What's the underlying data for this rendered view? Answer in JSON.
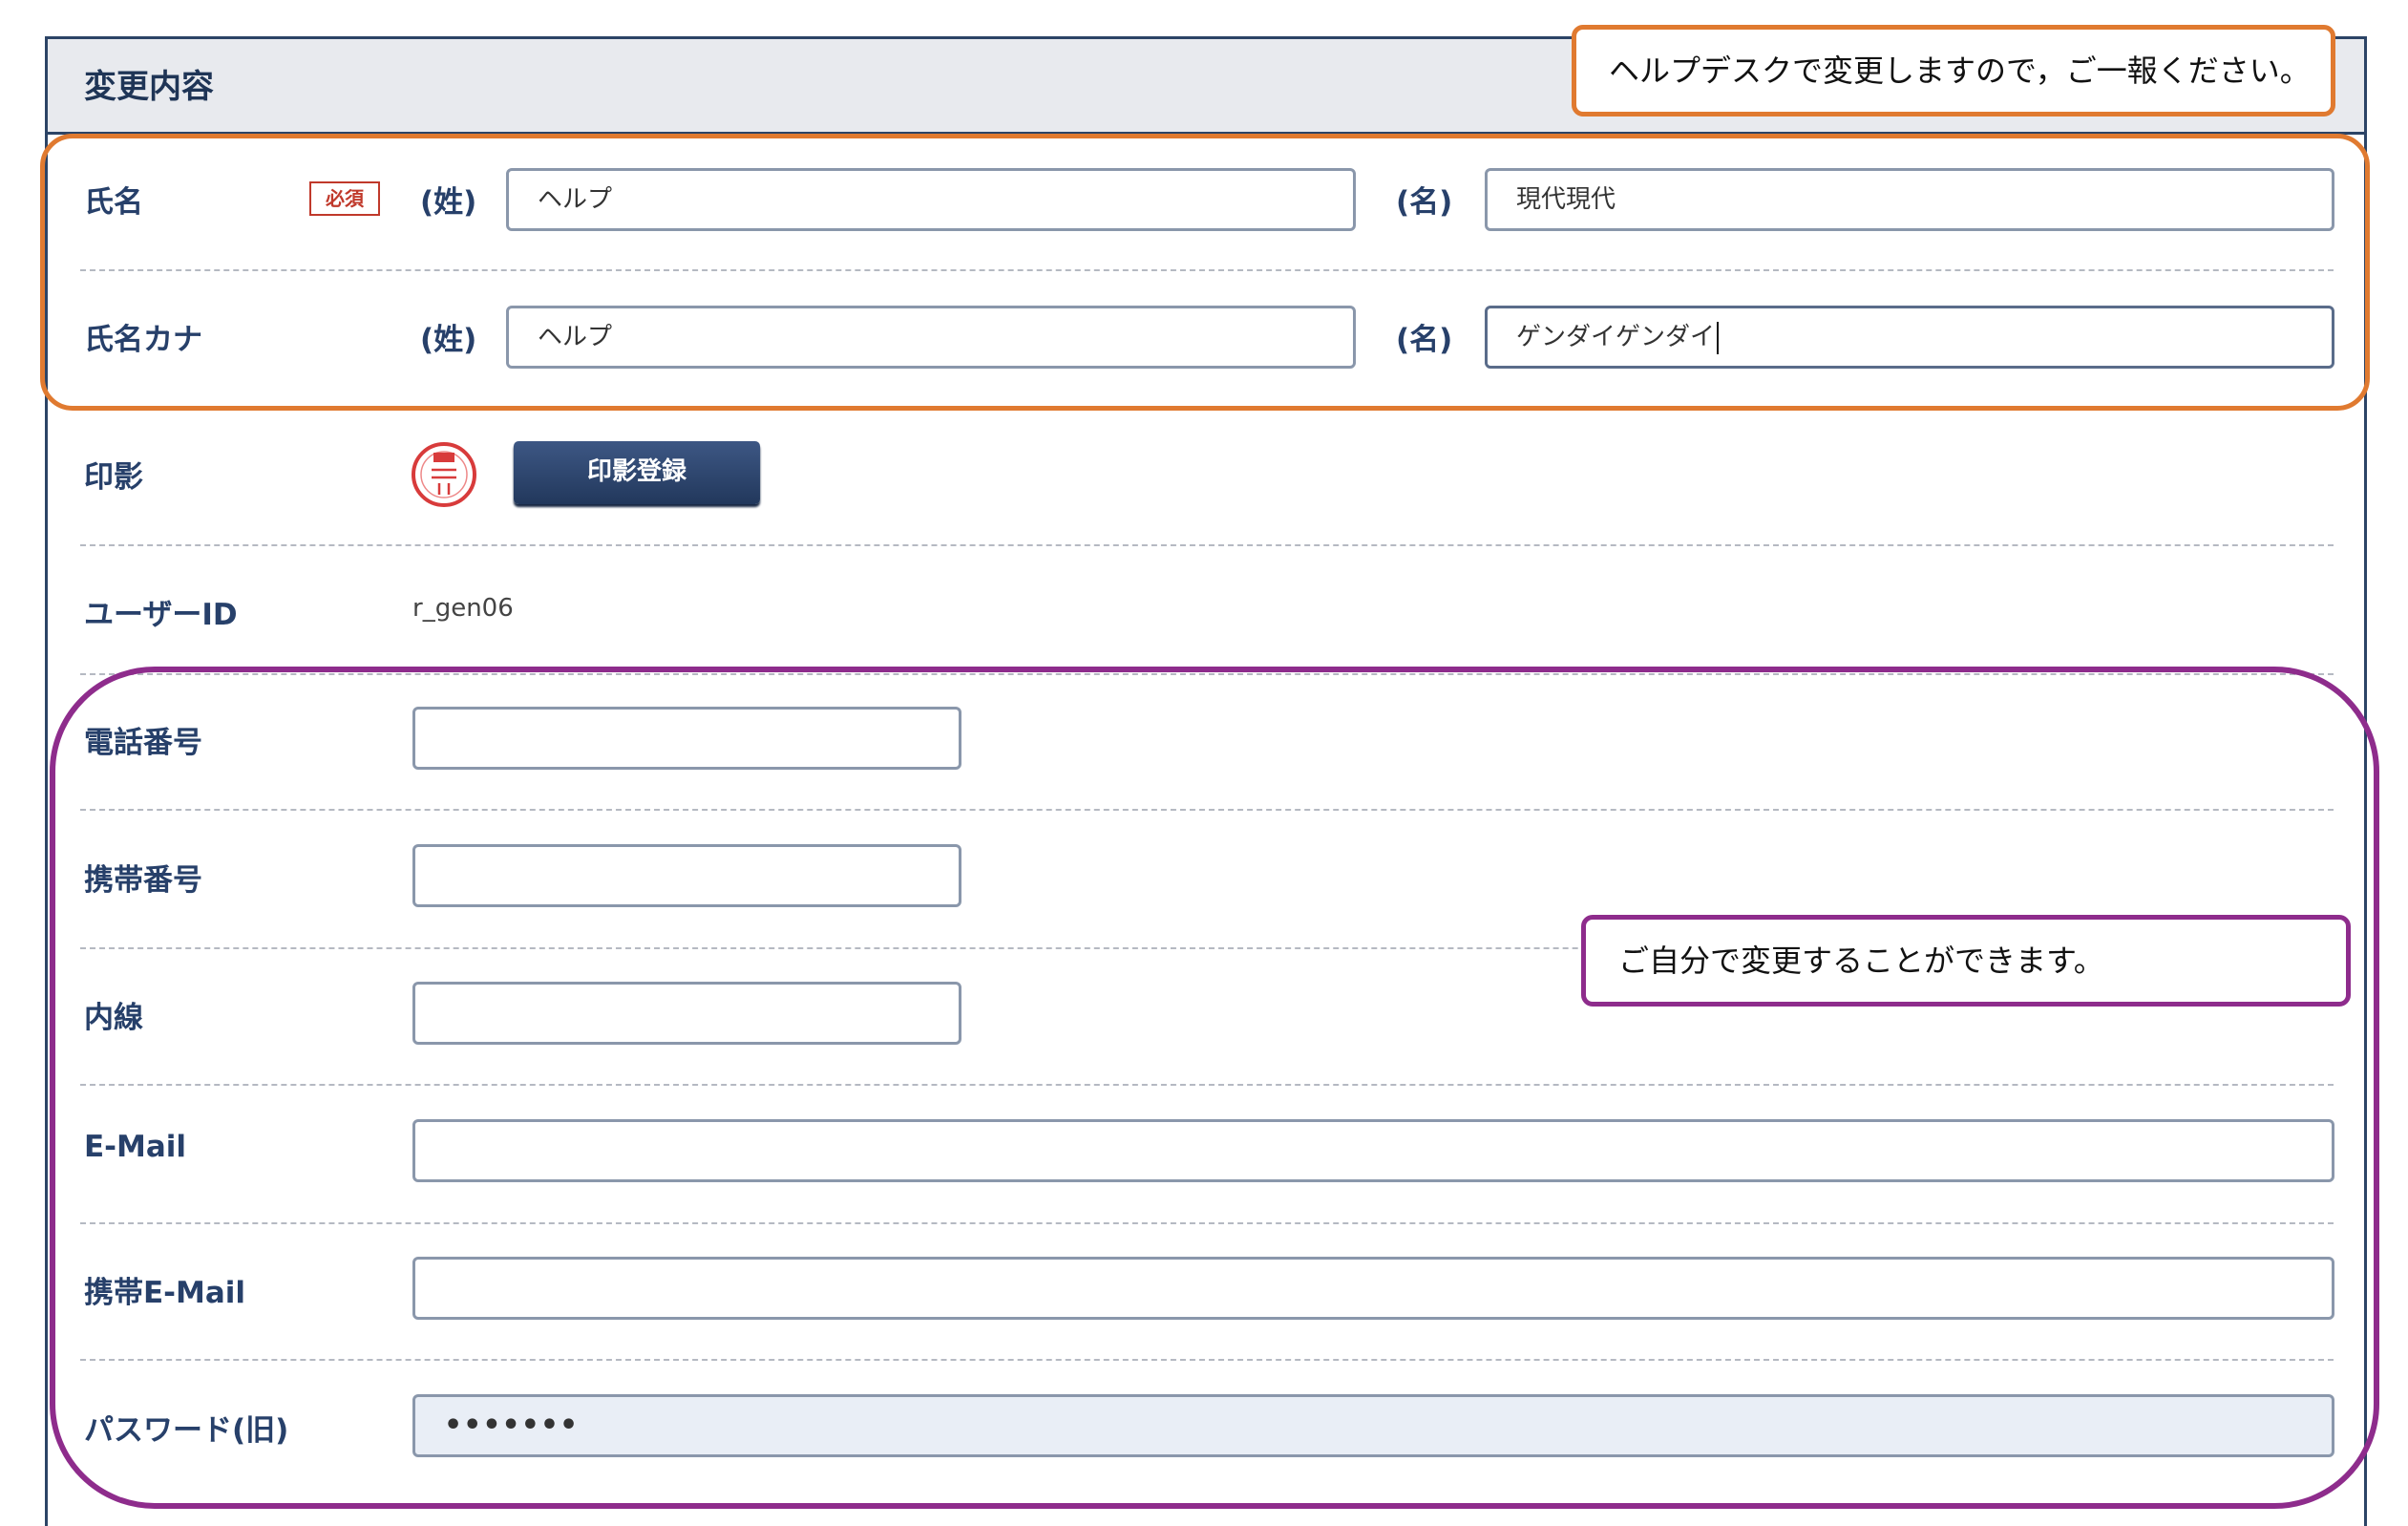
{
  "panel": {
    "title": "変更内容"
  },
  "callouts": {
    "helpdesk": "ヘルプデスクで変更しますので，ご一報ください。",
    "self": "ご自分で変更することができます。"
  },
  "name_row": {
    "label": "氏名",
    "required": "必須",
    "sei_label": "(姓)",
    "sei_value": "ヘルプ",
    "mei_label": "(名)",
    "mei_value": "現代現代"
  },
  "kana_row": {
    "label": "氏名カナ",
    "sei_label": "(姓)",
    "sei_value": "ヘルプ",
    "mei_label": "(名)",
    "mei_value": "ゲンダイゲンダイ"
  },
  "seal_row": {
    "label": "印影",
    "button": "印影登録"
  },
  "userid_row": {
    "label": "ユーザーID",
    "value": "r_gen06"
  },
  "phone_row": {
    "label": "電話番号",
    "value": ""
  },
  "mobile_row": {
    "label": "携帯番号",
    "value": ""
  },
  "extension_row": {
    "label": "内線",
    "value": ""
  },
  "email_row": {
    "label": "E-Mail",
    "value": ""
  },
  "mobile_email_row": {
    "label": "携帯E-Mail",
    "value": ""
  },
  "password_row": {
    "label": "パスワード(旧)",
    "value": "•••••••"
  },
  "colors": {
    "orange_frame": "#e07a30",
    "purple_frame": "#8e2c8c",
    "navy": "#2c4466"
  }
}
